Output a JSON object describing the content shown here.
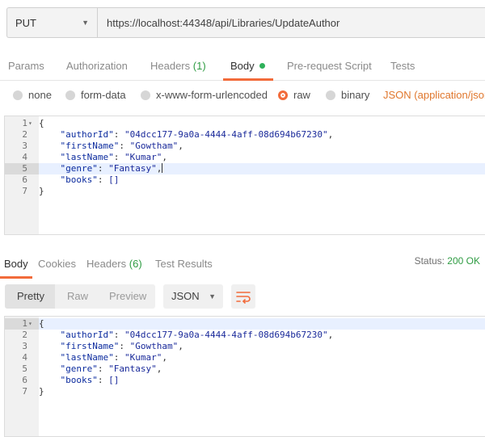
{
  "request": {
    "method": "PUT",
    "url": "https://localhost:44348/api/Libraries/UpdateAuthor"
  },
  "request_tabs": [
    {
      "label": "Params"
    },
    {
      "label": "Authorization"
    },
    {
      "label": "Headers",
      "count": "(1)"
    },
    {
      "label": "Body"
    },
    {
      "label": "Pre-request Script"
    },
    {
      "label": "Tests"
    }
  ],
  "body_modes": {
    "none": "none",
    "form_data": "form-data",
    "urlencoded": "x-www-form-urlencoded",
    "raw": "raw",
    "binary": "binary",
    "selected": "raw",
    "content_type": "JSON (application/json)"
  },
  "request_body": {
    "lines": [
      {
        "n": "1",
        "fold": "▾",
        "text": "{"
      },
      {
        "n": "2",
        "key": "\"authorId\"",
        "sep": ": ",
        "val": "\"04dcc177-9a0a-4444-4aff-08d694b67230\"",
        "tail": ","
      },
      {
        "n": "3",
        "key": "\"firstName\"",
        "sep": ": ",
        "val": "\"Gowtham\"",
        "tail": ","
      },
      {
        "n": "4",
        "key": "\"lastName\"",
        "sep": ": ",
        "val": "\"Kumar\"",
        "tail": ","
      },
      {
        "n": "5",
        "key": "\"genre\"",
        "sep": ": ",
        "val": "\"Fantasy\"",
        "tail": ","
      },
      {
        "n": "6",
        "key": "\"books\"",
        "sep": ": ",
        "val": "[]",
        "tail": ""
      },
      {
        "n": "7",
        "text": "}"
      }
    ],
    "active_line": "5"
  },
  "response_tabs": [
    {
      "label": "Body"
    },
    {
      "label": "Cookies"
    },
    {
      "label": "Headers",
      "count": "(6)"
    },
    {
      "label": "Test Results"
    }
  ],
  "status": {
    "label": "Status:",
    "value": "200 OK"
  },
  "response_view": {
    "modes": [
      "Pretty",
      "Raw",
      "Preview"
    ],
    "format": "JSON"
  },
  "response_body": {
    "lines": [
      {
        "n": "1",
        "fold": "▾",
        "text": "{"
      },
      {
        "n": "2",
        "key": "\"authorId\"",
        "sep": ": ",
        "val": "\"04dcc177-9a0a-4444-4aff-08d694b67230\"",
        "tail": ","
      },
      {
        "n": "3",
        "key": "\"firstName\"",
        "sep": ": ",
        "val": "\"Gowtham\"",
        "tail": ","
      },
      {
        "n": "4",
        "key": "\"lastName\"",
        "sep": ": ",
        "val": "\"Kumar\"",
        "tail": ","
      },
      {
        "n": "5",
        "key": "\"genre\"",
        "sep": ": ",
        "val": "\"Fantasy\"",
        "tail": ","
      },
      {
        "n": "6",
        "key": "\"books\"",
        "sep": ": ",
        "val": "[]",
        "tail": ""
      },
      {
        "n": "7",
        "text": "}"
      }
    ],
    "active_line": "1"
  },
  "colors": {
    "accent": "#f26b3a",
    "success": "#2f9c43",
    "json_type": "#e0772d"
  }
}
